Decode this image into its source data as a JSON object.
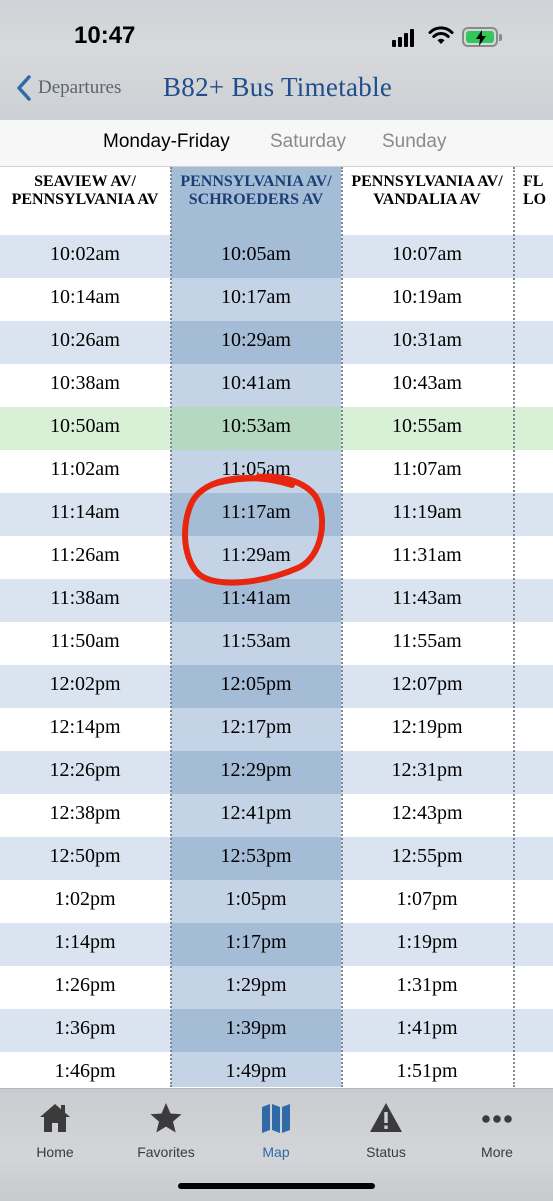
{
  "status": {
    "time": "10:47"
  },
  "nav": {
    "back_label": "Departures",
    "title": "B82+ Bus Timetable"
  },
  "tabs": [
    {
      "label": "Monday-Friday",
      "active": true
    },
    {
      "label": "Saturday",
      "active": false
    },
    {
      "label": "Sunday",
      "active": false
    }
  ],
  "columns": [
    {
      "line1": "SEAVIEW AV/",
      "line2": "PENNSYLVANIA AV",
      "highlighted": false
    },
    {
      "line1": "PENNSYLVANIA AV/",
      "line2": "SCHROEDERS AV",
      "highlighted": true
    },
    {
      "line1": "PENNSYLVANIA AV/",
      "line2": "VANDALIA AV",
      "highlighted": false
    },
    {
      "line1": "FL",
      "line2": "LO",
      "highlighted": false
    }
  ],
  "rows": [
    [
      "10:02am",
      "10:05am",
      "10:07am"
    ],
    [
      "10:14am",
      "10:17am",
      "10:19am"
    ],
    [
      "10:26am",
      "10:29am",
      "10:31am"
    ],
    [
      "10:38am",
      "10:41am",
      "10:43am"
    ],
    [
      "10:50am",
      "10:53am",
      "10:55am"
    ],
    [
      "11:02am",
      "11:05am",
      "11:07am"
    ],
    [
      "11:14am",
      "11:17am",
      "11:19am"
    ],
    [
      "11:26am",
      "11:29am",
      "11:31am"
    ],
    [
      "11:38am",
      "11:41am",
      "11:43am"
    ],
    [
      "11:50am",
      "11:53am",
      "11:55am"
    ],
    [
      "12:02pm",
      "12:05pm",
      "12:07pm"
    ],
    [
      "12:14pm",
      "12:17pm",
      "12:19pm"
    ],
    [
      "12:26pm",
      "12:29pm",
      "12:31pm"
    ],
    [
      "12:38pm",
      "12:41pm",
      "12:43pm"
    ],
    [
      "12:50pm",
      "12:53pm",
      "12:55pm"
    ],
    [
      "1:02pm",
      "1:05pm",
      "1:07pm"
    ],
    [
      "1:14pm",
      "1:17pm",
      "1:19pm"
    ],
    [
      "1:26pm",
      "1:29pm",
      "1:31pm"
    ],
    [
      "1:36pm",
      "1:39pm",
      "1:41pm"
    ],
    [
      "1:46pm",
      "1:49pm",
      "1:51pm"
    ]
  ],
  "highlighted_row_index": 4,
  "bottom_nav": [
    {
      "label": "Home",
      "icon": "home-icon",
      "active": false
    },
    {
      "label": "Favorites",
      "icon": "star-icon",
      "active": false
    },
    {
      "label": "Map",
      "icon": "map-icon",
      "active": true
    },
    {
      "label": "Status",
      "icon": "warning-icon",
      "active": false
    },
    {
      "label": "More",
      "icon": "more-icon",
      "active": false
    }
  ],
  "colors": {
    "accent": "#2f6aa6",
    "title": "#1f4e8c",
    "highlight_column": "#a5bcd6",
    "alt_row": "#d9e4f0",
    "current_row": "#d7f0d6",
    "annotation": "#e8260f"
  }
}
